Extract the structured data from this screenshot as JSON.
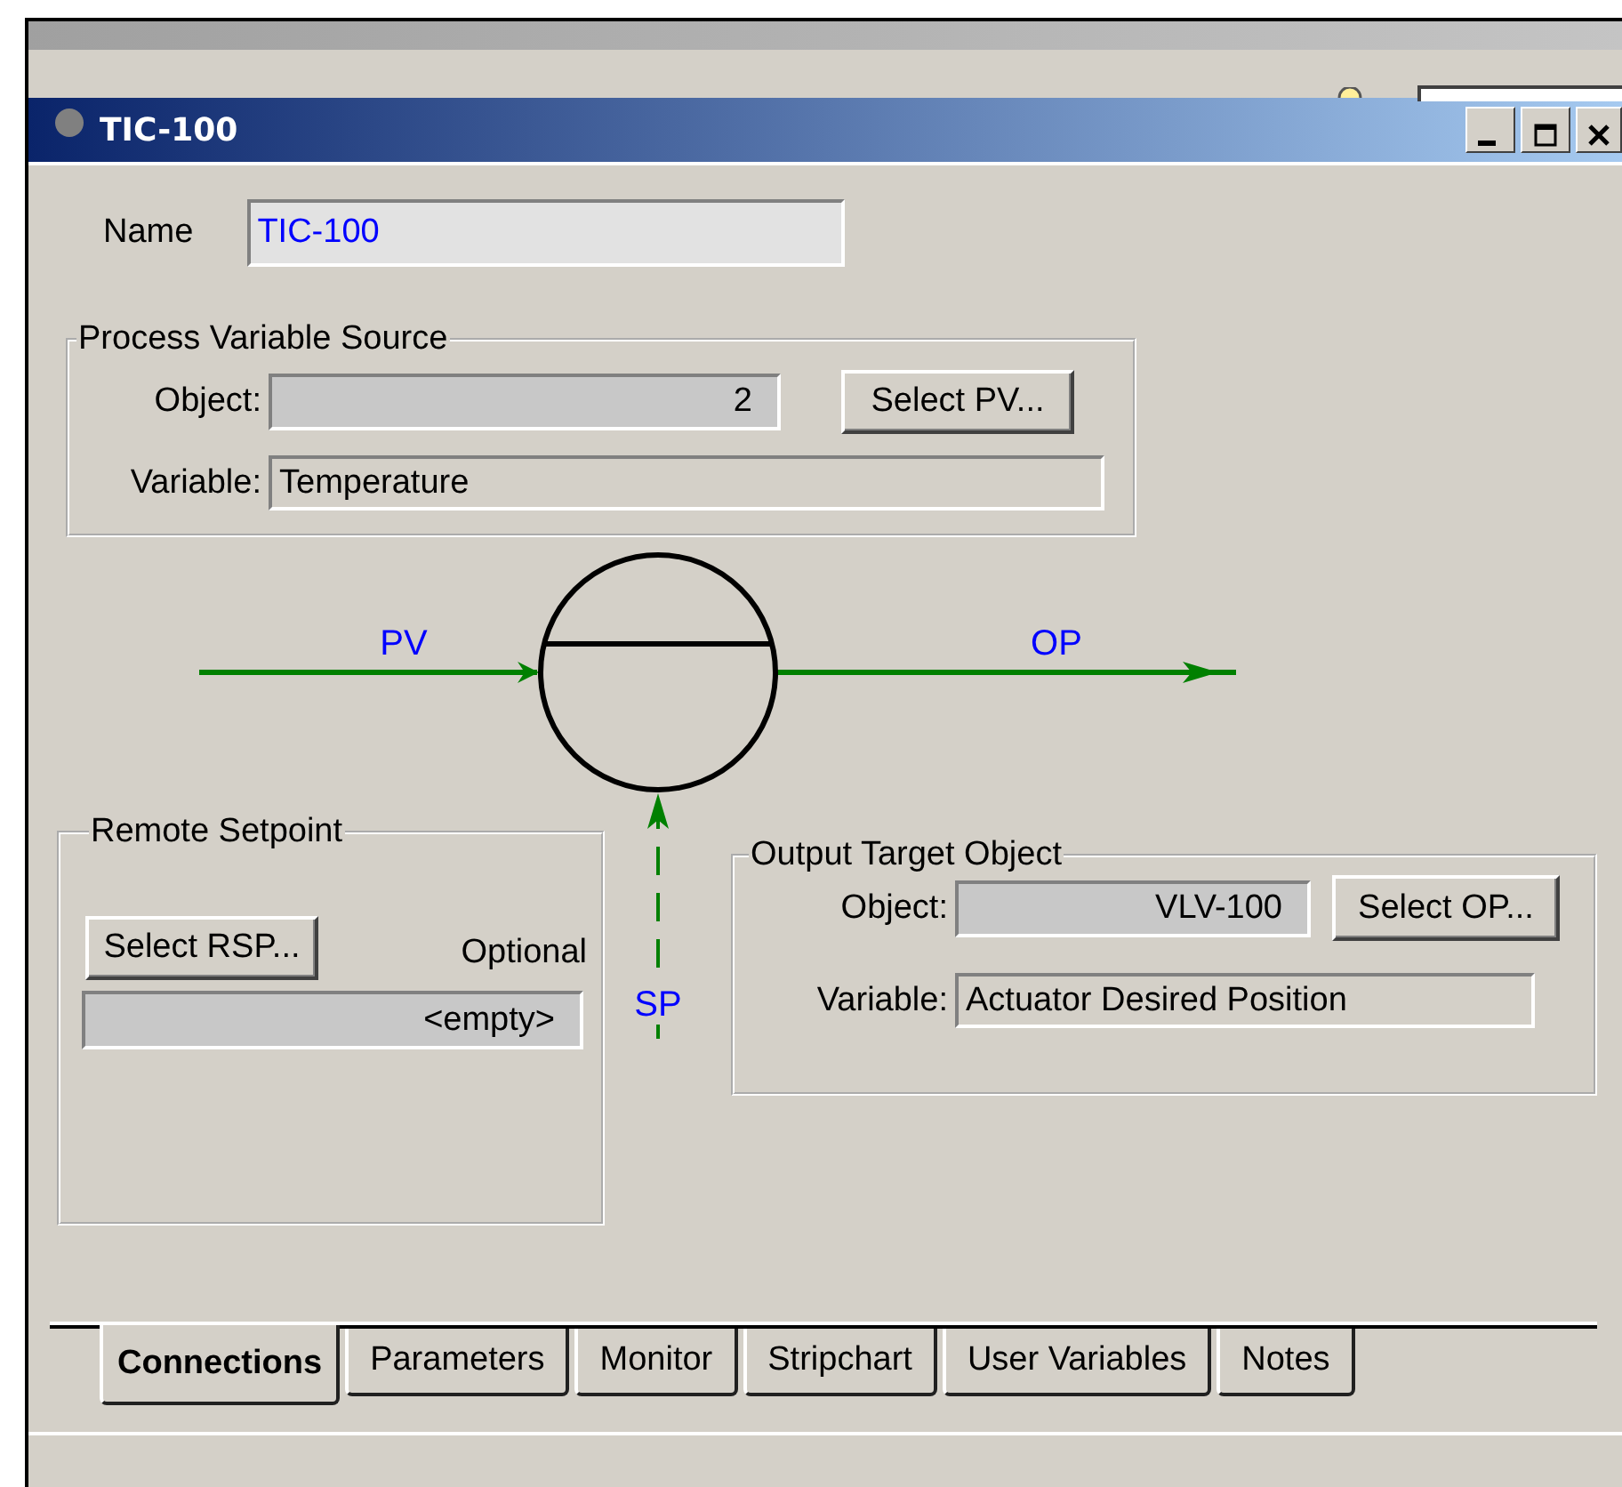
{
  "window": {
    "title": "TIC-100"
  },
  "name": {
    "label": "Name",
    "value": "TIC-100"
  },
  "pv_source": {
    "title": "Process Variable Source",
    "object_label": "Object:",
    "object_value": "2",
    "button": "Select PV...",
    "variable_label": "Variable:",
    "variable_value": "Temperature"
  },
  "diagram": {
    "pv_label": "PV",
    "op_label": "OP",
    "sp_label": "SP"
  },
  "remote_setpoint": {
    "title": "Remote Setpoint",
    "button": "Select RSP...",
    "optional": "Optional",
    "value": "<empty>"
  },
  "output_target": {
    "title": "Output Target Object",
    "object_label": "Object:",
    "object_value": "VLV-100",
    "button": "Select OP...",
    "variable_label": "Variable:",
    "variable_value": "Actuator Desired Position"
  },
  "tabs": [
    {
      "label": "Connections",
      "selected": true
    },
    {
      "label": "Parameters",
      "selected": false
    },
    {
      "label": "Monitor",
      "selected": false
    },
    {
      "label": "Stripchart",
      "selected": false
    },
    {
      "label": "User Variables",
      "selected": false
    },
    {
      "label": "Notes",
      "selected": false
    }
  ]
}
